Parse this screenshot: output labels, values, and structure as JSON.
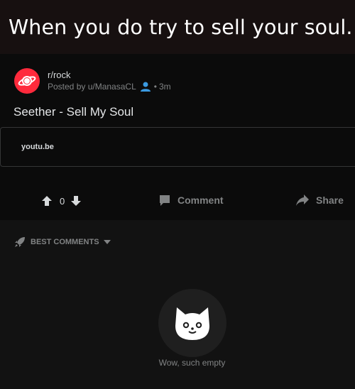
{
  "caption": "When you do try to sell your soul.",
  "post": {
    "subreddit": "r/rock",
    "posted_by": "Posted by u/ManasaCL",
    "dot": "•",
    "age": "3m",
    "title": "Seether - Sell My Soul",
    "link_domain": "youtu.be"
  },
  "actions": {
    "vote_count": "0",
    "comment_label": "Comment",
    "share_label": "Share"
  },
  "comments": {
    "sort_label": "BEST COMMENTS",
    "empty_text": "Wow, such empty"
  },
  "colors": {
    "accent": "#ff2a3c",
    "user_icon": "#3b9ae1",
    "muted": "#818384"
  },
  "icons": [
    "planet-icon",
    "user-icon",
    "upvote-icon",
    "downvote-icon",
    "comment-icon",
    "share-icon",
    "rocket-icon",
    "caret-down-icon",
    "cat-icon"
  ]
}
